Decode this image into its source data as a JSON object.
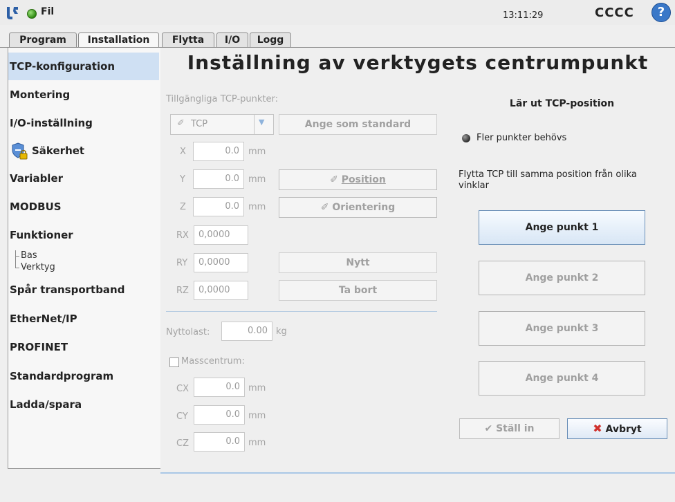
{
  "topbar": {
    "file": "Fil",
    "time": "13:11:29",
    "robot_name": "CCCC",
    "help": "?"
  },
  "tabs": [
    "Program",
    "Installation",
    "Flytta",
    "I/O",
    "Logg"
  ],
  "sidebar": {
    "items": [
      "TCP-konfiguration",
      "Montering",
      "I/O-inställning",
      "Säkerhet",
      "Variabler",
      "MODBUS",
      "Funktioner",
      "Spår transportband",
      "EtherNet/IP",
      "PROFINET",
      "Standardprogram",
      "Ladda/spara"
    ],
    "sub_items": [
      "Bas",
      "Verktyg"
    ]
  },
  "main": {
    "title": "Inställning av verktygets centrumpunkt",
    "available_label": "Tillgängliga TCP-punkter:",
    "tcp_select": "TCP",
    "set_default": "Ange som standard",
    "coords": [
      {
        "label": "X",
        "value": "0.0",
        "unit": "mm"
      },
      {
        "label": "Y",
        "value": "0.0",
        "unit": "mm"
      },
      {
        "label": "Z",
        "value": "0.0",
        "unit": "mm"
      },
      {
        "label": "RX",
        "value": "0,0000"
      },
      {
        "label": "RY",
        "value": "0,0000"
      },
      {
        "label": "RZ",
        "value": "0,0000"
      }
    ],
    "position_btn": "Position",
    "orientation_btn": "Orientering",
    "new_btn": "Nytt",
    "delete_btn": "Ta bort",
    "payload_label": "Nyttolast:",
    "payload_value": "0.00",
    "payload_unit": "kg",
    "cog_label": "Masscentrum:",
    "cog": [
      {
        "label": "CX",
        "value": "0.0",
        "unit": "mm"
      },
      {
        "label": "CY",
        "value": "0.0",
        "unit": "mm"
      },
      {
        "label": "CZ",
        "value": "0.0",
        "unit": "mm"
      }
    ]
  },
  "teach": {
    "heading": "Lär ut TCP-position",
    "status": "Fler punkter behövs",
    "instruction": "Flytta TCP till samma position från olika vinklar",
    "points": [
      "Ange punkt 1",
      "Ange punkt 2",
      "Ange punkt 3",
      "Ange punkt 4"
    ],
    "set_btn": "Ställ in",
    "cancel_btn": "Avbryt"
  }
}
